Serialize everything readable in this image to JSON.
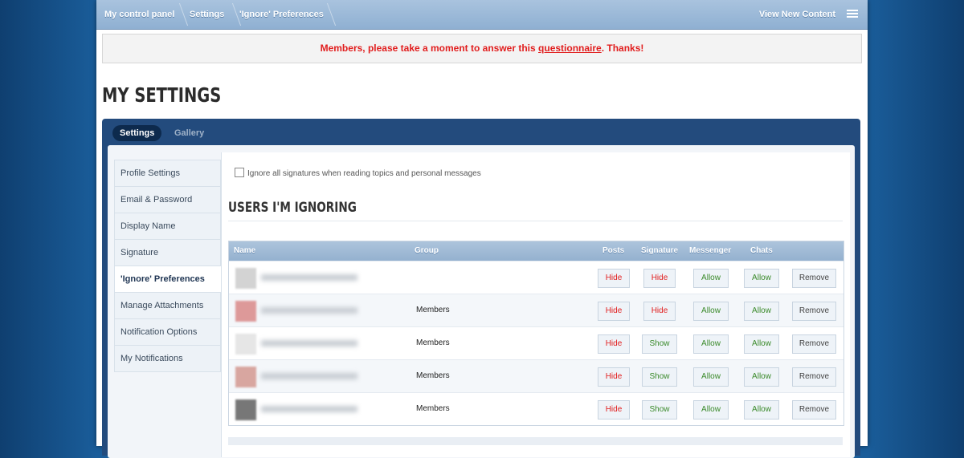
{
  "breadcrumb": [
    "My control panel",
    "Settings",
    "'Ignore' Preferences"
  ],
  "top_right": {
    "view_new_content": "View New Content",
    "menu_icon": "list-menu-icon"
  },
  "notice": {
    "before": "Members, please take a moment to answer this ",
    "link": "questionnaire",
    "after": ". Thanks!",
    "color": "#e11d1d"
  },
  "page_title": "MY SETTINGS",
  "tabs": {
    "active": "Settings",
    "other": "Gallery"
  },
  "sidebar": {
    "items": [
      "Profile Settings",
      "Email & Password",
      "Display Name",
      "Signature",
      "'Ignore' Preferences",
      "Manage Attachments",
      "Notification Options",
      "My Notifications"
    ],
    "active_index": 4
  },
  "option": {
    "label": "Ignore all signatures when reading topics and personal messages"
  },
  "section_title": "USERS I'M IGNORING",
  "table": {
    "headers": {
      "name": "Name",
      "group": "Group",
      "posts": "Posts",
      "signature": "Signature",
      "messenger": "Messenger",
      "chats": "Chats"
    },
    "rows": [
      {
        "group": "",
        "posts": "Hide",
        "signature": "Hide",
        "messenger": "Allow",
        "chats": "Allow",
        "remove": "Remove"
      },
      {
        "group": "Members",
        "posts": "Hide",
        "signature": "Hide",
        "messenger": "Allow",
        "chats": "Allow",
        "remove": "Remove"
      },
      {
        "group": "Members",
        "posts": "Hide",
        "signature": "Show",
        "messenger": "Allow",
        "chats": "Allow",
        "remove": "Remove"
      },
      {
        "group": "Members",
        "posts": "Hide",
        "signature": "Show",
        "messenger": "Allow",
        "chats": "Allow",
        "remove": "Remove"
      },
      {
        "group": "Members",
        "posts": "Hide",
        "signature": "Show",
        "messenger": "Allow",
        "chats": "Allow",
        "remove": "Remove"
      }
    ]
  }
}
